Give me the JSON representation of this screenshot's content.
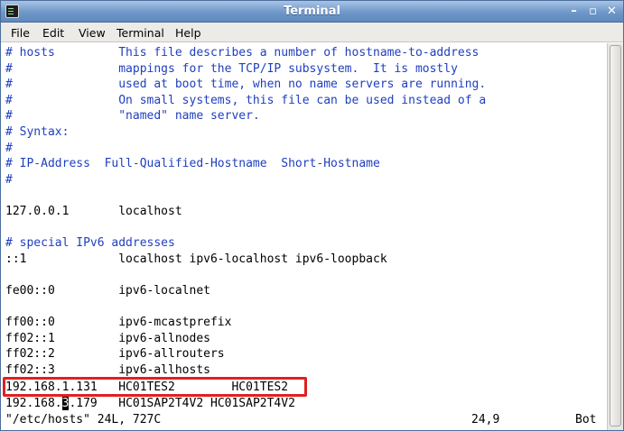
{
  "window": {
    "title": "Terminal",
    "controls": {
      "minimize": "–",
      "maximize": "▫",
      "close": "✕"
    }
  },
  "menu": {
    "items": [
      "File",
      "Edit",
      "View",
      "Terminal",
      "Help"
    ]
  },
  "terminal": {
    "lines": [
      {
        "text": "# hosts         This file describes a number of hostname-to-address",
        "style": "comment"
      },
      {
        "text": "#               mappings for the TCP/IP subsystem.  It is mostly",
        "style": "comment"
      },
      {
        "text": "#               used at boot time, when no name servers are running.",
        "style": "comment"
      },
      {
        "text": "#               On small systems, this file can be used instead of a",
        "style": "comment"
      },
      {
        "text": "#               \"named\" name server.",
        "style": "comment"
      },
      {
        "text": "# Syntax:",
        "style": "comment"
      },
      {
        "text": "#",
        "style": "comment"
      },
      {
        "text": "# IP-Address  Full-Qualified-Hostname  Short-Hostname",
        "style": "comment"
      },
      {
        "text": "#",
        "style": "comment"
      },
      {
        "text": "",
        "style": "normal"
      },
      {
        "text": "127.0.0.1       localhost",
        "style": "normal"
      },
      {
        "text": "",
        "style": "normal"
      },
      {
        "text": "# special IPv6 addresses",
        "style": "comment"
      },
      {
        "text": "::1             localhost ipv6-localhost ipv6-loopback",
        "style": "normal"
      },
      {
        "text": "",
        "style": "normal"
      },
      {
        "text": "fe00::0         ipv6-localnet",
        "style": "normal"
      },
      {
        "text": "",
        "style": "normal"
      },
      {
        "text": "ff00::0         ipv6-mcastprefix",
        "style": "normal"
      },
      {
        "text": "ff02::1         ipv6-allnodes",
        "style": "normal"
      },
      {
        "text": "ff02::2         ipv6-allrouters",
        "style": "normal"
      },
      {
        "text": "ff02::3         ipv6-allhosts",
        "style": "normal"
      },
      {
        "text": "192.168.1.131   HC01TES2        HC01TES2",
        "style": "normal"
      },
      {
        "text": "192.168.",
        "cursor": "3",
        "rest": ".179   HC01SAP2T4V2 HC01SAP2T4V2",
        "style": "cursorline"
      }
    ],
    "status": {
      "file": "\"/etc/hosts\" 24L, 727C",
      "position": "24,9",
      "scroll": "Bot"
    }
  },
  "colors": {
    "comment": "#1f3fbf",
    "titlebar": "#6f97c8",
    "highlight": "#e02020"
  }
}
